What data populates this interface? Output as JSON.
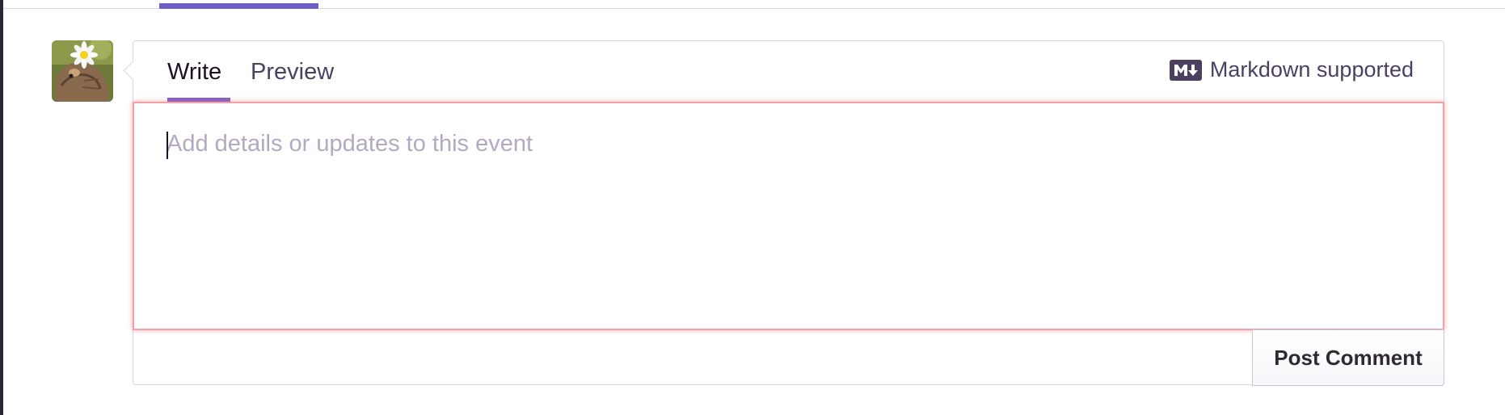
{
  "tabs": {
    "write_label": "Write",
    "preview_label": "Preview",
    "active": "Write"
  },
  "markdown": {
    "icon": "markdown-icon",
    "label": "Markdown supported"
  },
  "comment": {
    "value": "",
    "placeholder": "Add details or updates to this event"
  },
  "actions": {
    "post_label": "Post Comment"
  },
  "user": {
    "avatar_icon": "user-avatar-photo"
  },
  "colors": {
    "accent": "#6c5fc7",
    "tab_underline": "#7e63c7",
    "error_border": "#f2a0a8",
    "text_primary": "#1d1127",
    "text_secondary": "#4b4060",
    "placeholder": "#b3a9c1"
  }
}
